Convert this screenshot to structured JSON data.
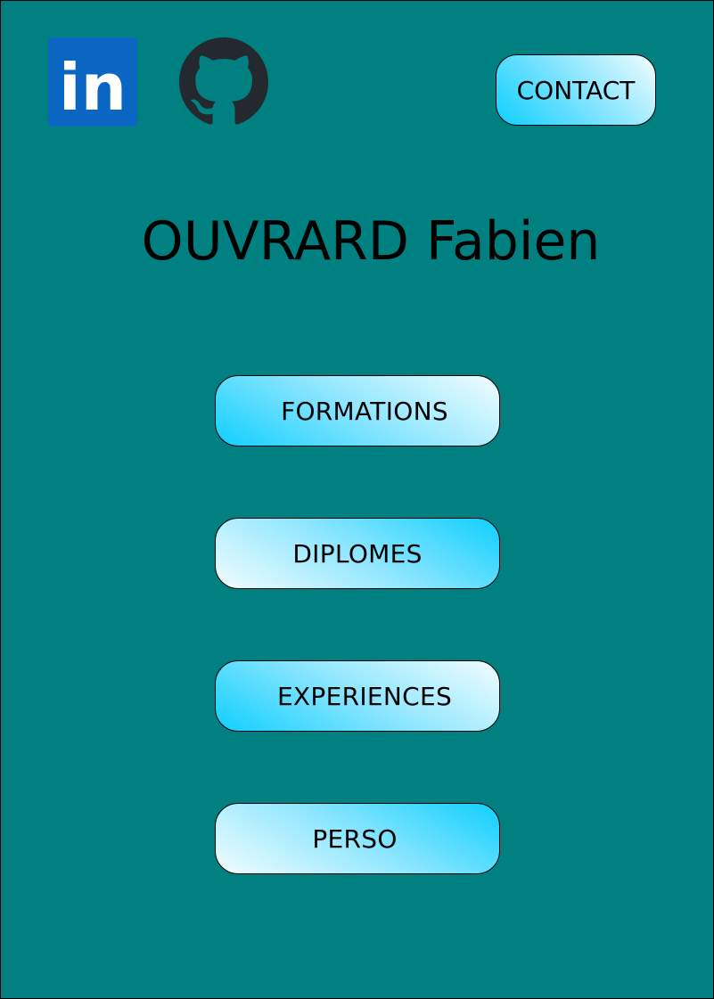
{
  "page": {
    "background_color": "#008080"
  },
  "social": {
    "linkedin": {
      "icon": "linkedin-icon",
      "label": "in",
      "color": "#0a66c2"
    },
    "github": {
      "icon": "github-icon",
      "color": "#24292f"
    }
  },
  "header": {
    "contact_label": "CONTACT"
  },
  "hero": {
    "name": "OUVRARD Fabien"
  },
  "menu": {
    "items": [
      {
        "label": "FORMATIONS"
      },
      {
        "label": "DIPLOMES"
      },
      {
        "label": "EXPERIENCES"
      },
      {
        "label": "PERSO"
      }
    ]
  },
  "colors": {
    "button_gradient_start": "#0fd0ff",
    "button_gradient_end": "#f2fdff"
  }
}
